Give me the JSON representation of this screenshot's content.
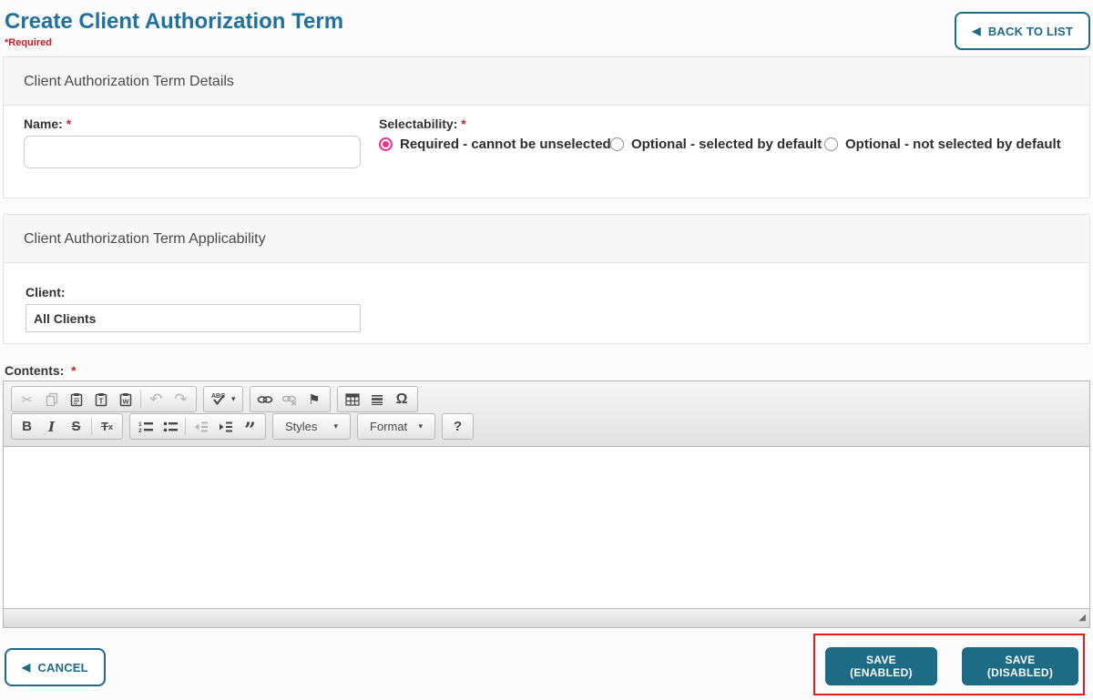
{
  "colors": {
    "accent_title": "#21719e",
    "accent_button": "#1d6b88",
    "save_button_bg": "#1e6b86",
    "required_red": "#cc2127",
    "annotation_red": "#e11f1f",
    "radio_selected_pink": "#e8368f",
    "panel_header_bg": "#f7f7f7"
  },
  "page": {
    "title": "Create Client Authorization Term",
    "required_note": "*Required"
  },
  "header": {
    "back_to_list_label": "BACK TO LIST",
    "back_icon": "left-triangle-icon"
  },
  "details": {
    "panel_title": "Client Authorization Term Details",
    "name_label": "Name:",
    "name_value": "",
    "required_marker": "*",
    "selectability": {
      "label": "Selectability:",
      "required_marker": "*",
      "options": [
        {
          "label": "Required - cannot be unselected",
          "selected": true
        },
        {
          "label": "Optional - selected by default",
          "selected": false
        },
        {
          "label": "Optional - not selected by default",
          "selected": false
        }
      ]
    }
  },
  "applicability": {
    "panel_title": "Client Authorization Term Applicability",
    "client_label": "Client:",
    "client_value": "All Clients"
  },
  "editor": {
    "label": "Contents:",
    "required_marker": "*",
    "content_value": "",
    "toolbar": {
      "styles_label": "Styles",
      "format_label": "Format",
      "help_label": "?",
      "row1_icons": [
        "cut-icon",
        "copy-icon",
        "paste-icon",
        "paste-plain-text-icon",
        "paste-from-word-icon",
        "undo-icon",
        "redo-icon",
        "spellcheck-icon",
        "link-icon",
        "unlink-icon",
        "anchor-flag-icon",
        "table-icon",
        "horizontal-rule-icon",
        "special-character-icon"
      ],
      "row2_icons": [
        "bold-icon",
        "italic-icon",
        "strikethrough-icon",
        "remove-format-icon",
        "numbered-list-icon",
        "bulleted-list-icon",
        "decrease-indent-icon",
        "increase-indent-icon",
        "blockquote-icon"
      ],
      "disabled_icons": [
        "cut-icon",
        "copy-icon",
        "undo-icon",
        "redo-icon",
        "unlink-icon",
        "decrease-indent-icon"
      ]
    },
    "resize_handle": "resize-corner-icon"
  },
  "footer": {
    "cancel_label": "CANCEL",
    "save_enabled_label": "SAVE (ENABLED)",
    "save_disabled_label": "SAVE (DISABLED)"
  }
}
